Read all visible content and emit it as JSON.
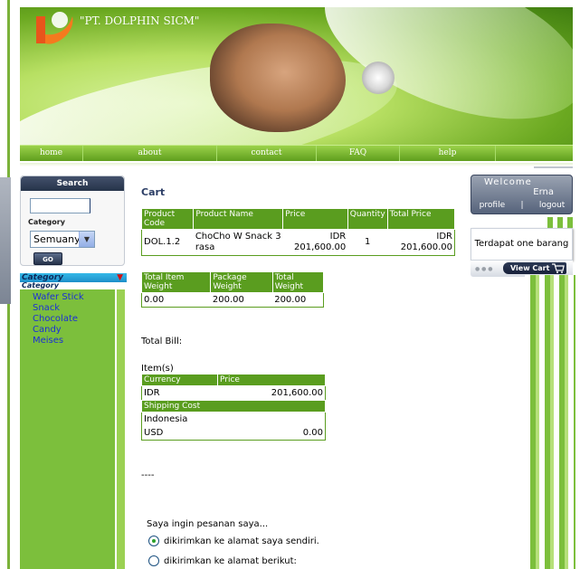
{
  "brand": {
    "logo_text": "\"PT. DOLPHIN SICM\""
  },
  "nav": {
    "items": [
      "home",
      "about",
      "contact",
      "FAQ",
      "help"
    ]
  },
  "search": {
    "title": "Search",
    "category_label": "Category",
    "category_selected": "Semuanya",
    "go_label": "GO"
  },
  "category_panel": {
    "title": "Category",
    "subtitle": "Category",
    "items": [
      "Wafer Stick",
      "Snack",
      "Chocolate",
      "Candy",
      "Meises"
    ]
  },
  "cart": {
    "title": "Cart",
    "columns": [
      "Product Code",
      "Product Name",
      "Price",
      "Quantity",
      "Total Price"
    ],
    "rows": [
      {
        "code": "DOL.1.2",
        "name": "ChoCho W Snack 3 rasa",
        "price": "IDR 201,600.00",
        "quantity": "1",
        "total": "IDR 201,600.00"
      }
    ]
  },
  "weight": {
    "columns": [
      "Total Item Weight",
      "Package Weight",
      "Total Weight"
    ],
    "values": [
      "0.00",
      "200.00",
      "200.00"
    ]
  },
  "bill": {
    "total_bill_label": "Total Bill:",
    "items_label": "Item(s)",
    "columns": [
      "Currency",
      "Price"
    ],
    "currency": "IDR",
    "price": "201,600.00",
    "shipping_header": "Shipping Cost",
    "shipping_country": "Indonesia",
    "shipping_currency": "USD",
    "shipping_price": "0.00",
    "dashes": "----"
  },
  "order": {
    "prompt": "Saya ingin pesanan saya...",
    "option_1": "dikirimkan ke alamat saya sendiri.",
    "option_2": "dikirimkan ke alamat berikut:",
    "selected": "option_1"
  },
  "welcome": {
    "title": "Welcome",
    "user": "Erna",
    "profile_link": "profile",
    "separator": "|",
    "logout_link": "logout"
  },
  "cart_widget": {
    "info": "Terdapat one barang",
    "view_cart_label": "View Cart"
  },
  "colors": {
    "nav_green": "#5f9e1d",
    "header_green": "#5a9d1f",
    "category_panel": "#7cbf3c",
    "link_blue": "#1b2fd6",
    "search_header": "#26334a"
  }
}
